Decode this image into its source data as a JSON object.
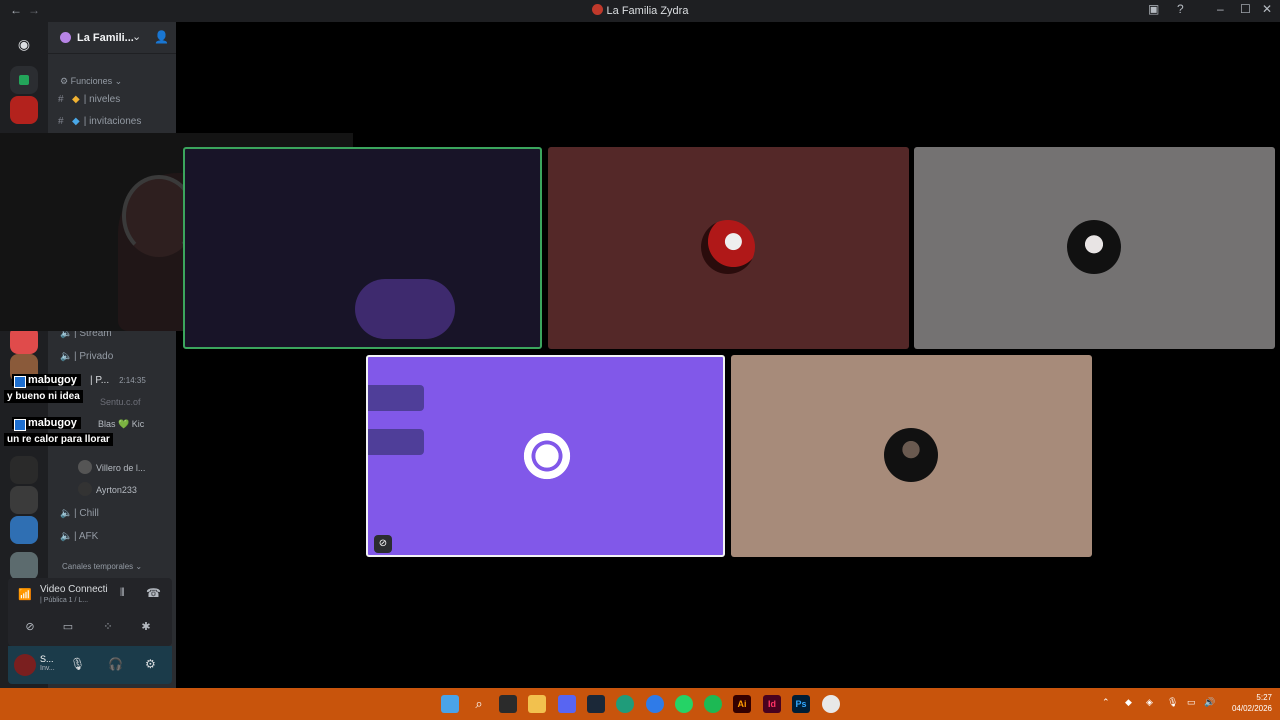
{
  "window": {
    "title": "La Familia Zydra",
    "back": "←",
    "forward": "→"
  },
  "guild": {
    "name": "La Famili...",
    "chevron": "⌄"
  },
  "channels": {
    "category_funciones": "⚙ Funciones ⌄",
    "text": [
      {
        "name": "| niveles"
      },
      {
        "name": "| invitaciones"
      }
    ],
    "voice": [
      {
        "name": "| Stream"
      },
      {
        "name": "| Privado"
      }
    ],
    "voice_active": {
      "name": "| P...",
      "timer": "2:14:35"
    },
    "voice_users_partial": [
      "Sentu.c.of",
      "Blas 💚 Kic"
    ],
    "voice_users": [
      {
        "name": "Villero de l..."
      },
      {
        "name": "Ayrton233"
      }
    ],
    "voice_more": [
      {
        "name": "| Chill"
      },
      {
        "name": "| AFK"
      }
    ],
    "category_temporales": "Canales temporales ⌄"
  },
  "voice_panel": {
    "status": "Video Connecti",
    "subtitle": "| Pública 1 / L..."
  },
  "user_panel": {
    "name": "S...",
    "status": "Inv..."
  },
  "chat_overlay": [
    {
      "user": "mabugoy",
      "message": "y bueno ni idea"
    },
    {
      "user": "mabugoy",
      "message": "un re calor para llorar"
    }
  ],
  "colors": {
    "speaking": "#3ba55d",
    "tile_2": "#542828",
    "tile_3": "#747272",
    "tile_4": "#8158e9",
    "tile_5": "#a78b7a",
    "taskbar": "#c8540c"
  },
  "icons": {
    "taskbar": [
      "windows-icon",
      "search-icon",
      "terminal-icon",
      "folder-icon",
      "discord-icon",
      "steam-icon",
      "edge-icon",
      "app-icon",
      "whatsapp-icon",
      "spotify-icon",
      "illustrator-icon",
      "indesign-icon",
      "photoshop-icon",
      "chrome-icon"
    ],
    "taskbar_labels": {
      "ai": "Ai",
      "id": "Id",
      "ps": "Ps"
    }
  },
  "clock": {
    "time": "5:27",
    "date": "04/02/2026"
  }
}
